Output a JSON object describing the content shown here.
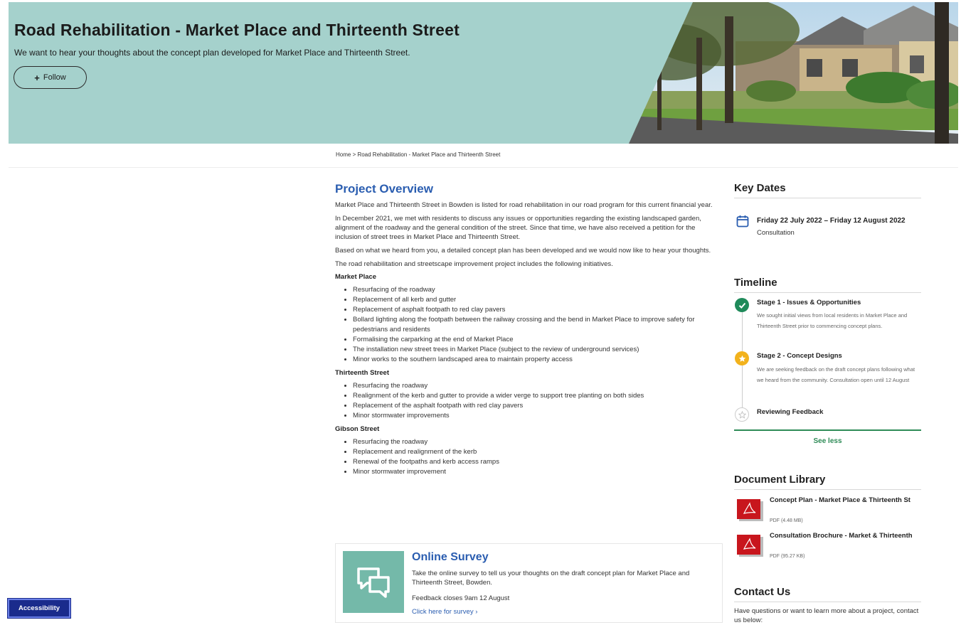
{
  "hero": {
    "title": "Road Rehabilitation - Market Place and Thirteenth Street",
    "subtitle": "We want to hear your thoughts about the concept plan developed for Market Place and Thirteenth Street.",
    "follow_icon": "plus-icon",
    "follow_label": "Follow",
    "background_color": "#a5d1cc"
  },
  "breadcrumb": "Home > Road Rehabilitation - Market Place and Thirteenth Street",
  "overview": {
    "heading": "Project Overview",
    "paragraphs": [
      "Market Place and Thirteenth Street in Bowden is listed for road rehabilitation in our road program for this current financial year.",
      "In December 2021, we met with residents to discuss any issues or opportunities regarding the existing landscaped garden, alignment of the roadway and the general condition of the street. Since that time, we have also received a petition for the inclusion of street trees in Market Place and Thirteenth Street.",
      "Based on what we heard from you, a detailed concept plan has been developed and we would now like to hear your thoughts.",
      "The road rehabilitation and streetscape improvement project includes the following initiatives."
    ],
    "sections": [
      {
        "heading": "Market Place",
        "items": [
          "Resurfacing of the roadway",
          "Replacement of all kerb and gutter",
          "Replacement of asphalt footpath to red clay pavers",
          "Bollard lighting along the footpath between the railway crossing and the bend in Market Place to improve safety for pedestrians and residents",
          "Formalising the carparking at the end of Market Place",
          "The installation new street trees in Market Place (subject to the review of underground services)",
          "Minor works to the southern landscaped area to maintain property access"
        ]
      },
      {
        "heading": "Thirteenth Street",
        "items": [
          "Resurfacing the roadway",
          "Realignment of the kerb and gutter to provide a wider verge to support tree planting on both sides",
          "Replacement of the asphalt footpath with red clay pavers",
          "Minor stormwater improvements"
        ]
      },
      {
        "heading": "Gibson Street",
        "items": [
          "Resurfacing the roadway",
          "Replacement and realignment of the kerb",
          "Renewal of the footpaths and kerb access ramps",
          "Minor stormwater improvement"
        ]
      }
    ]
  },
  "survey": {
    "icon": "chat-bubbles-icon",
    "title": "Online Survey",
    "text": "Take the online survey to tell us your thoughts on the draft concept plan for Market Place and Thirteenth Street, Bowden.",
    "closes": "Feedback closes 9am 12 August",
    "link_label": "Click here for survey ›"
  },
  "key_dates": {
    "heading": "Key Dates",
    "icon": "calendar-icon",
    "date": "Friday 22 July 2022 – Friday 12 August 2022",
    "label": "Consultation"
  },
  "timeline": {
    "heading": "Timeline",
    "stages": [
      {
        "title": "Stage 1 - Issues & Opportunities",
        "desc": "We sought initial views from local residents in Market Place and Thirteenth Street prior to commencing concept plans.",
        "status": "complete",
        "icon": "check-icon",
        "color": "#1f8a5a"
      },
      {
        "title": "Stage 2 - Concept Designs",
        "desc": "We are seeking feedback on the draft concept plans following what we heard from the community. Consultation open until 12 August",
        "status": "current",
        "icon": "star-icon",
        "color": "#f2b21c"
      },
      {
        "title": "Reviewing Feedback",
        "desc": "",
        "status": "upcoming",
        "icon": "star-outline-icon",
        "color": "#cccccc"
      }
    ],
    "toggle_label": "See less"
  },
  "documents": {
    "heading": "Document Library",
    "items": [
      {
        "icon": "pdf-icon",
        "title": "Concept Plan - Market Place & Thirteenth St",
        "meta": "PDF (4.48 MB)"
      },
      {
        "icon": "pdf-icon",
        "title": "Consultation Brochure - Market & Thirteenth",
        "meta": "PDF (95.27 KB)"
      }
    ]
  },
  "contact": {
    "heading": "Contact Us",
    "text": "Have questions or want to learn more about a project, contact us below:"
  },
  "accessibility_label": "Accessibility",
  "colors": {
    "link_blue": "#2a5db0",
    "green": "#2e8b57",
    "accessibility_bg": "#1a2b8c"
  }
}
